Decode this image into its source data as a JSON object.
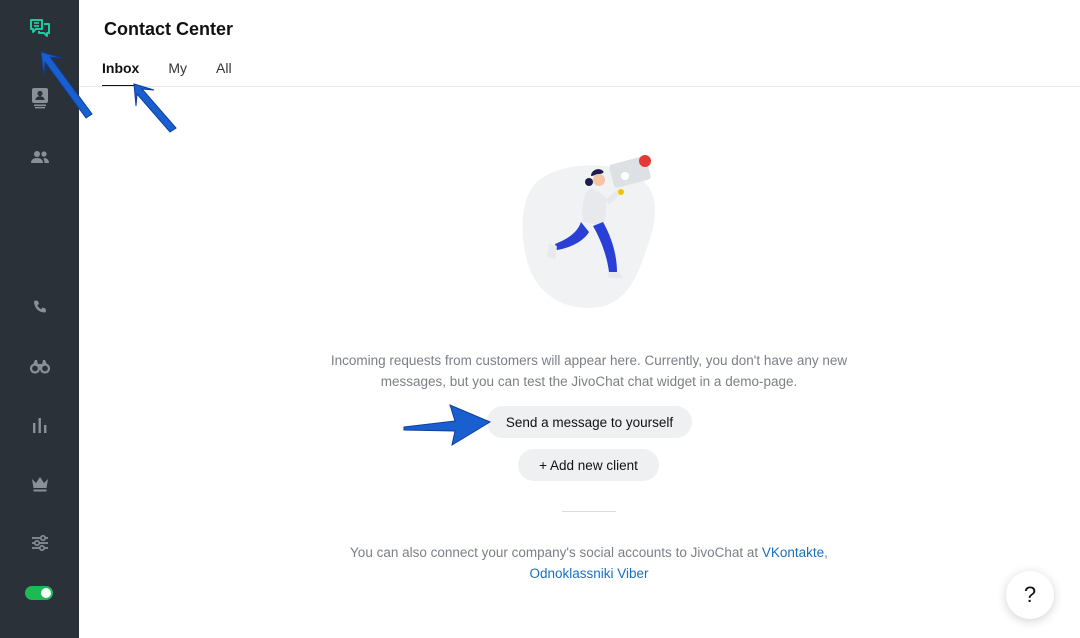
{
  "header": {
    "title": "Contact Center"
  },
  "tabs": [
    {
      "label": "Inbox",
      "active": true
    },
    {
      "label": "My",
      "active": false
    },
    {
      "label": "All",
      "active": false
    }
  ],
  "sidebar": {
    "items": [
      {
        "icon": "chat-bubbles-icon",
        "active": true
      },
      {
        "icon": "contact-card-icon"
      },
      {
        "icon": "team-icon"
      },
      {
        "icon": "phone-icon"
      },
      {
        "icon": "binoculars-icon"
      },
      {
        "icon": "bar-chart-icon"
      },
      {
        "icon": "crown-icon"
      },
      {
        "icon": "settings-sliders-icon"
      }
    ],
    "status_toggle": {
      "on": true
    }
  },
  "empty_state": {
    "description": "Incoming requests from customers will appear here. Currently, you don't have any new messages, but you can test the JivoChat chat widget in a demo-page.",
    "send_button": "Send a message to yourself",
    "add_client_button": "+ Add new client"
  },
  "footer": {
    "text": "You can also connect your company's social accounts to JivoChat at",
    "links": [
      "VKontakte",
      "Odnoklassniki",
      "Viber"
    ],
    "sep1": ",",
    "sep2": " "
  },
  "help": {
    "label": "?"
  },
  "colors": {
    "sidebar_bg": "#2b3139",
    "accent_green": "#1db954",
    "active_icon": "#1ec8a0",
    "link": "#1a6fbf",
    "annotation_arrow": "#1a5fd0"
  }
}
